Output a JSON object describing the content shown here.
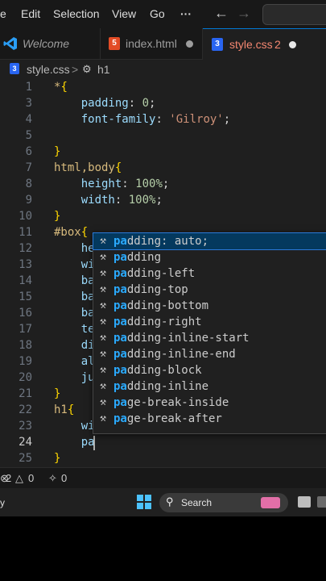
{
  "menubar": {
    "items": [
      "e",
      "Edit",
      "Selection",
      "View",
      "Go",
      "···"
    ],
    "back_icon": "arrow-left-icon",
    "forward_icon": "arrow-right-icon"
  },
  "tabs": [
    {
      "label": "Welcome",
      "icon": "vscode-logo-icon"
    },
    {
      "label": "index.html",
      "icon": "html5-icon",
      "icon_text": "5"
    },
    {
      "label": "style.css",
      "icon": "css3-icon",
      "icon_text": "3",
      "badge": "2",
      "active": true
    }
  ],
  "breadcrumb": {
    "file": "style.css",
    "separator": ">",
    "symbol": "h1"
  },
  "editor": {
    "line_numbers": [
      "1",
      "3",
      "4",
      "5",
      "6",
      "7",
      "8",
      "9",
      "10",
      "11",
      "12",
      "13",
      "14",
      "15",
      "16",
      "17",
      "18",
      "19",
      "20",
      "21",
      "22",
      "23",
      "24",
      "25"
    ],
    "current_line": "24",
    "lines": [
      [
        "*",
        "{"
      ],
      [
        "    padding",
        ": ",
        "0",
        ";"
      ],
      [
        "    font-family",
        ": ",
        "'Gilroy'",
        ";"
      ],
      [
        ""
      ],
      [
        "}"
      ],
      [
        "html,body",
        "{"
      ],
      [
        "    height",
        ": ",
        "100%",
        ";"
      ],
      [
        "    width",
        ": ",
        "100%",
        ";"
      ],
      [
        "}"
      ],
      [
        "#box",
        "{"
      ],
      [
        "    he"
      ],
      [
        "    wi"
      ],
      [
        "    ba"
      ],
      [
        "    ba"
      ],
      [
        "    ba"
      ],
      [
        "    te"
      ],
      [
        "    di"
      ],
      [
        "    al"
      ],
      [
        "    ju"
      ],
      [
        "}"
      ],
      [
        "h1",
        "{"
      ],
      [
        "    wi"
      ],
      [
        "    pa"
      ],
      [
        "}"
      ]
    ]
  },
  "suggest": {
    "typed": "pa",
    "items": [
      "padding: auto;",
      "padding",
      "padding-left",
      "padding-top",
      "padding-bottom",
      "padding-right",
      "padding-inline-start",
      "padding-inline-end",
      "padding-block",
      "padding-inline",
      "page-break-inside",
      "page-break-after"
    ],
    "item_icon": "wrench-icon"
  },
  "statusbar": {
    "errors": "2",
    "warnings": "0",
    "ports": "0"
  },
  "taskbar": {
    "left_text": "y",
    "search_label": "Search"
  },
  "colors": {
    "accent": "#0078d4",
    "selector": "#d7ba7d",
    "property": "#9cdcfe",
    "number": "#b5cea8",
    "string": "#ce9178",
    "error_badge": "#f14c4c"
  }
}
